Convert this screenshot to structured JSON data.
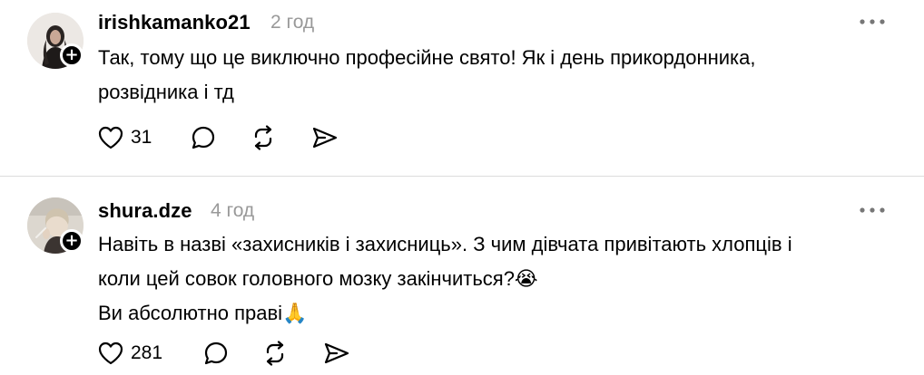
{
  "posts": [
    {
      "username": "irishkamanko21",
      "time": "2 год",
      "lines": [
        "Так, тому що це виключно професійне свято! Як і день прикордонника,",
        "розвідника і тд"
      ],
      "like_count": "31",
      "avatar_icon": "avatar-photo-woman-dark-hair"
    },
    {
      "username": "shura.dze",
      "time": "4 год",
      "lines": [
        "Навіть в назві «захисників і захисниць». З чим дівчата привітають хлопців і",
        "коли цей совок головного мозку закінчиться?😭",
        "Ви абсолютно праві🙏"
      ],
      "like_count": "281",
      "avatar_icon": "avatar-photo-woman-light-hair"
    }
  ],
  "icons": {
    "follow": "plus-icon",
    "more": "more-horizontal-icon",
    "like": "heart-icon",
    "comment": "comment-bubble-icon",
    "repost": "repost-icon",
    "share": "send-icon"
  },
  "badge": {
    "follow_symbol": "+"
  },
  "colors": {
    "text": "#000000",
    "muted": "#999999",
    "divider": "#dcdcdc",
    "background": "#ffffff"
  }
}
